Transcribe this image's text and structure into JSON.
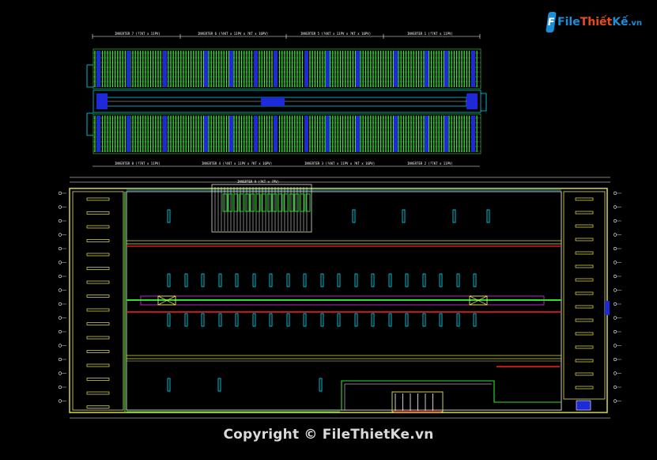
{
  "watermark": {
    "logo_prefix": "File",
    "logo_name_a": "Thiết",
    "logo_name_b": "Kế",
    "logo_suffix": ".vn"
  },
  "footer": {
    "copyright": "Copyright © FileThietKe.vn"
  },
  "drawing": {
    "top_inverter_labels": [
      "INVERTER 7 (?7KT x 11PV)",
      "INVERTER 6 (?4KT x 11PV x ?KT x 16PV)",
      "INVERTER 5 (?4KT x 11PV x ?KT x 16PV)",
      "INVERTER 1 (?7KT x 11PV)"
    ],
    "bottom_inverter_labels": [
      "INVERTER 8 (?7KT x 11PV)",
      "INVERTER 4 (?4KT x 11PV x ?KT x 16PV)",
      "INVERTER 3 (?4KT x 11PV x ?KT x 16PV)",
      "INVERTER 2 (?7KT x 11PV)"
    ],
    "plan_inverter_label": "INVERTER 9 (?KT x ?PV)",
    "colors": {
      "pv_green": "#2fe02f",
      "module_blue": "#1e2ad8",
      "cyan": "#00e5ff",
      "yellow": "#e8e84a",
      "red": "#ff2020",
      "magenta": "#c020c0",
      "white": "#ffffff"
    }
  }
}
